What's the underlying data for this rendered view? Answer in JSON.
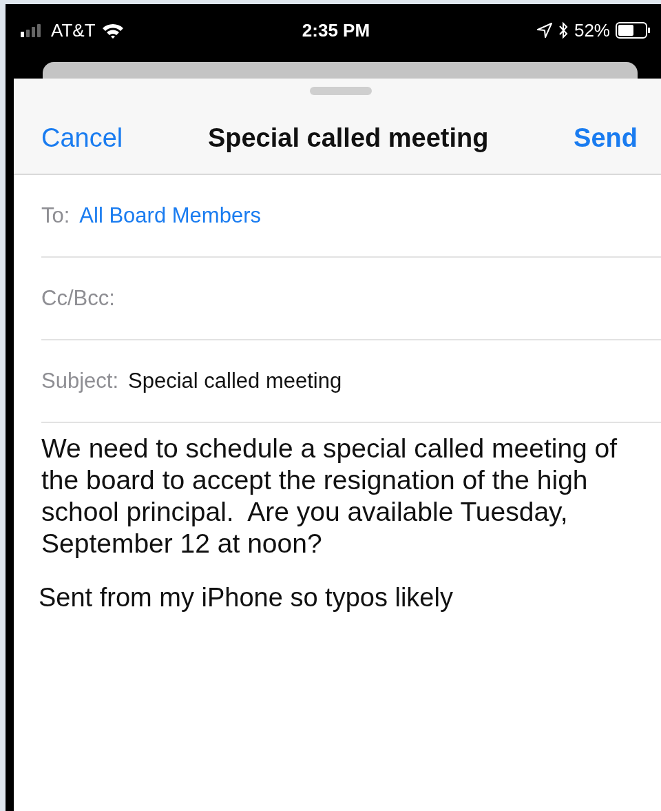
{
  "status_bar": {
    "carrier": "AT&T",
    "time": "2:35 PM",
    "battery": "52%"
  },
  "compose": {
    "cancel": "Cancel",
    "title": "Special called meeting",
    "send": "Send"
  },
  "fields": [
    {
      "label": "To:",
      "kind": "recipients",
      "value": "All Board Members"
    },
    {
      "label": "Cc/Bcc:"
    },
    {
      "label": "Subject:",
      "kind": "text",
      "value": "Special called meeting"
    }
  ],
  "body": "We need to schedule a special called meeting of the board to accept the resignation of the high school principal.  Are you available Tuesday, September 12 at noon?",
  "signature": "Sent from my iPhone so typos likely"
}
